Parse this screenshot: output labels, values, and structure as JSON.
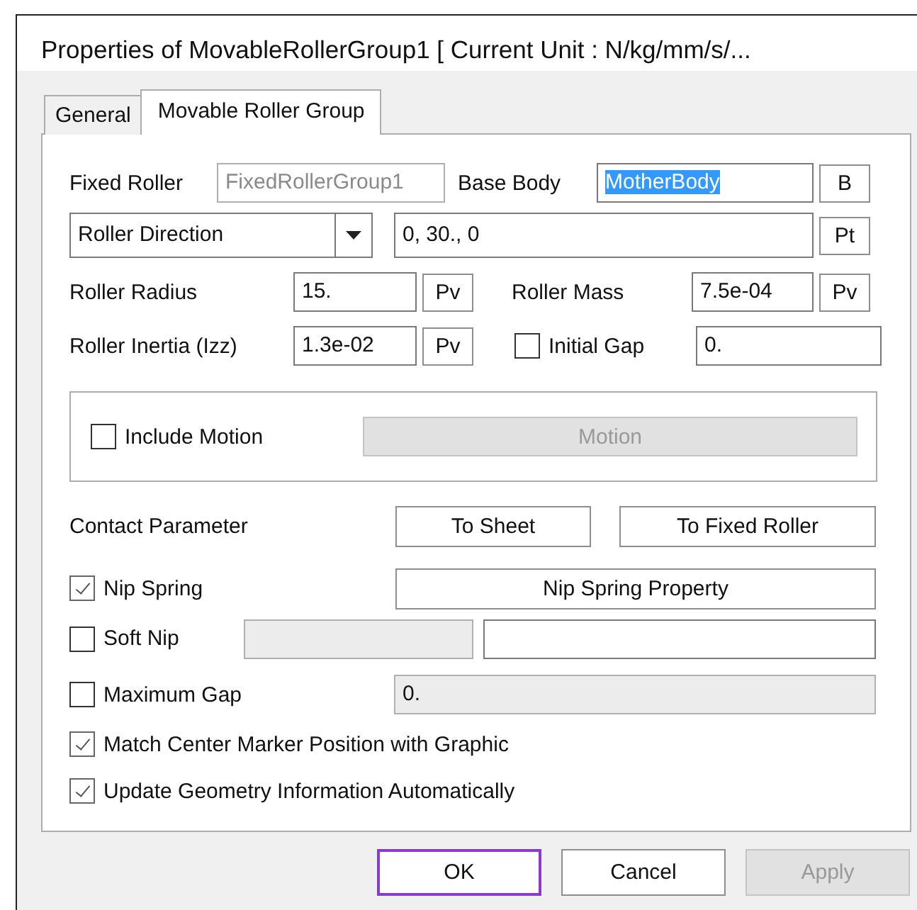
{
  "window": {
    "title": "Properties of MovableRollerGroup1 [ Current Unit : N/kg/mm/s/..."
  },
  "tabs": [
    {
      "label": "General",
      "selected": false
    },
    {
      "label": "Movable Roller Group",
      "selected": true
    }
  ],
  "fixed_roller": {
    "label": "Fixed Roller",
    "value": "FixedRollerGroup1",
    "disabled": true
  },
  "base_body": {
    "label": "Base Body",
    "value": "MotherBody",
    "text_selected": true,
    "button": "B"
  },
  "direction": {
    "dropdown": "Roller Direction",
    "value": "0, 30., 0",
    "button": "Pt"
  },
  "roller_radius": {
    "label": "Roller Radius",
    "value": "15.",
    "button": "Pv"
  },
  "roller_mass": {
    "label": "Roller Mass",
    "value": "7.5e-04",
    "button": "Pv"
  },
  "roller_inertia": {
    "label": "Roller Inertia (Izz)",
    "value": "1.3e-02",
    "button": "Pv"
  },
  "initial_gap": {
    "label": "Initial Gap",
    "checked": false,
    "value": "0."
  },
  "include_motion": {
    "label": "Include Motion",
    "checked": false,
    "button": "Motion",
    "button_disabled": true
  },
  "contact_parameter": {
    "label": "Contact Parameter",
    "buttons": [
      "To Sheet",
      "To Fixed Roller"
    ]
  },
  "nip_spring": {
    "label": "Nip Spring",
    "checked": true,
    "button": "Nip Spring Property"
  },
  "soft_nip": {
    "label": "Soft Nip",
    "checked": false,
    "field_disabled": true
  },
  "maximum_gap": {
    "label": "Maximum Gap",
    "checked": false,
    "value": "0.",
    "disabled": true
  },
  "options": [
    {
      "label": "Match Center Marker Position with Graphic",
      "checked": true
    },
    {
      "label": "Update Geometry Information Automatically",
      "checked": true
    }
  ],
  "buttons": [
    {
      "label": "OK",
      "focused": true,
      "disabled": false
    },
    {
      "label": "Cancel",
      "focused": false,
      "disabled": false
    },
    {
      "label": "Apply",
      "focused": false,
      "disabled": true
    }
  ]
}
